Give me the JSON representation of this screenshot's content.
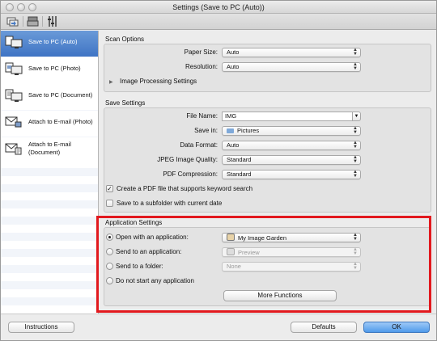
{
  "window": {
    "title": "Settings (Save to PC (Auto))"
  },
  "toolbar": {
    "icons": [
      "scan-from-computer-icon",
      "scan-from-operation-panel-icon",
      "general-settings-icon"
    ]
  },
  "sidebar": {
    "items": [
      {
        "label": "Save to PC (Auto)",
        "icon": "save-to-pc-auto-icon",
        "selected": true
      },
      {
        "label": "Save to PC (Photo)",
        "icon": "save-to-pc-photo-icon",
        "selected": false
      },
      {
        "label": "Save to PC (Document)",
        "icon": "save-to-pc-document-icon",
        "selected": false
      },
      {
        "label": "Attach to E-mail (Photo)",
        "icon": "attach-email-photo-icon",
        "selected": false
      },
      {
        "label_line1": "Attach to E-mail",
        "label_line2": "(Document)",
        "icon": "attach-email-document-icon",
        "selected": false
      }
    ]
  },
  "scan_options": {
    "title": "Scan Options",
    "paper_size_label": "Paper Size:",
    "paper_size_value": "Auto",
    "resolution_label": "Resolution:",
    "resolution_value": "Auto",
    "image_processing_label": "Image Processing Settings"
  },
  "save_settings": {
    "title": "Save Settings",
    "file_name_label": "File Name:",
    "file_name_value": "IMG",
    "save_in_label": "Save in:",
    "save_in_value": "Pictures",
    "data_format_label": "Data Format:",
    "data_format_value": "Auto",
    "jpeg_quality_label": "JPEG Image Quality:",
    "jpeg_quality_value": "Standard",
    "pdf_compression_label": "PDF Compression:",
    "pdf_compression_value": "Standard",
    "create_pdf_keyword_label": "Create a PDF file that supports keyword search",
    "create_pdf_keyword_checked": true,
    "save_subfolder_label": "Save to a subfolder with current date",
    "save_subfolder_checked": false
  },
  "application_settings": {
    "title": "Application Settings",
    "open_with_label": "Open with an application:",
    "open_with_value": "My Image Garden",
    "send_to_app_label": "Send to an application:",
    "send_to_app_value": "Preview",
    "send_to_folder_label": "Send to a folder:",
    "send_to_folder_value": "None",
    "do_not_start_label": "Do not start any application",
    "selected_option": "open_with",
    "more_functions_label": "More Functions"
  },
  "buttons": {
    "instructions_label": "Instructions",
    "defaults_label": "Defaults",
    "ok_label": "OK"
  },
  "colors": {
    "highlight": "#e2191e",
    "selection": "#3f74c4",
    "ok_button": "#4f9aea"
  }
}
